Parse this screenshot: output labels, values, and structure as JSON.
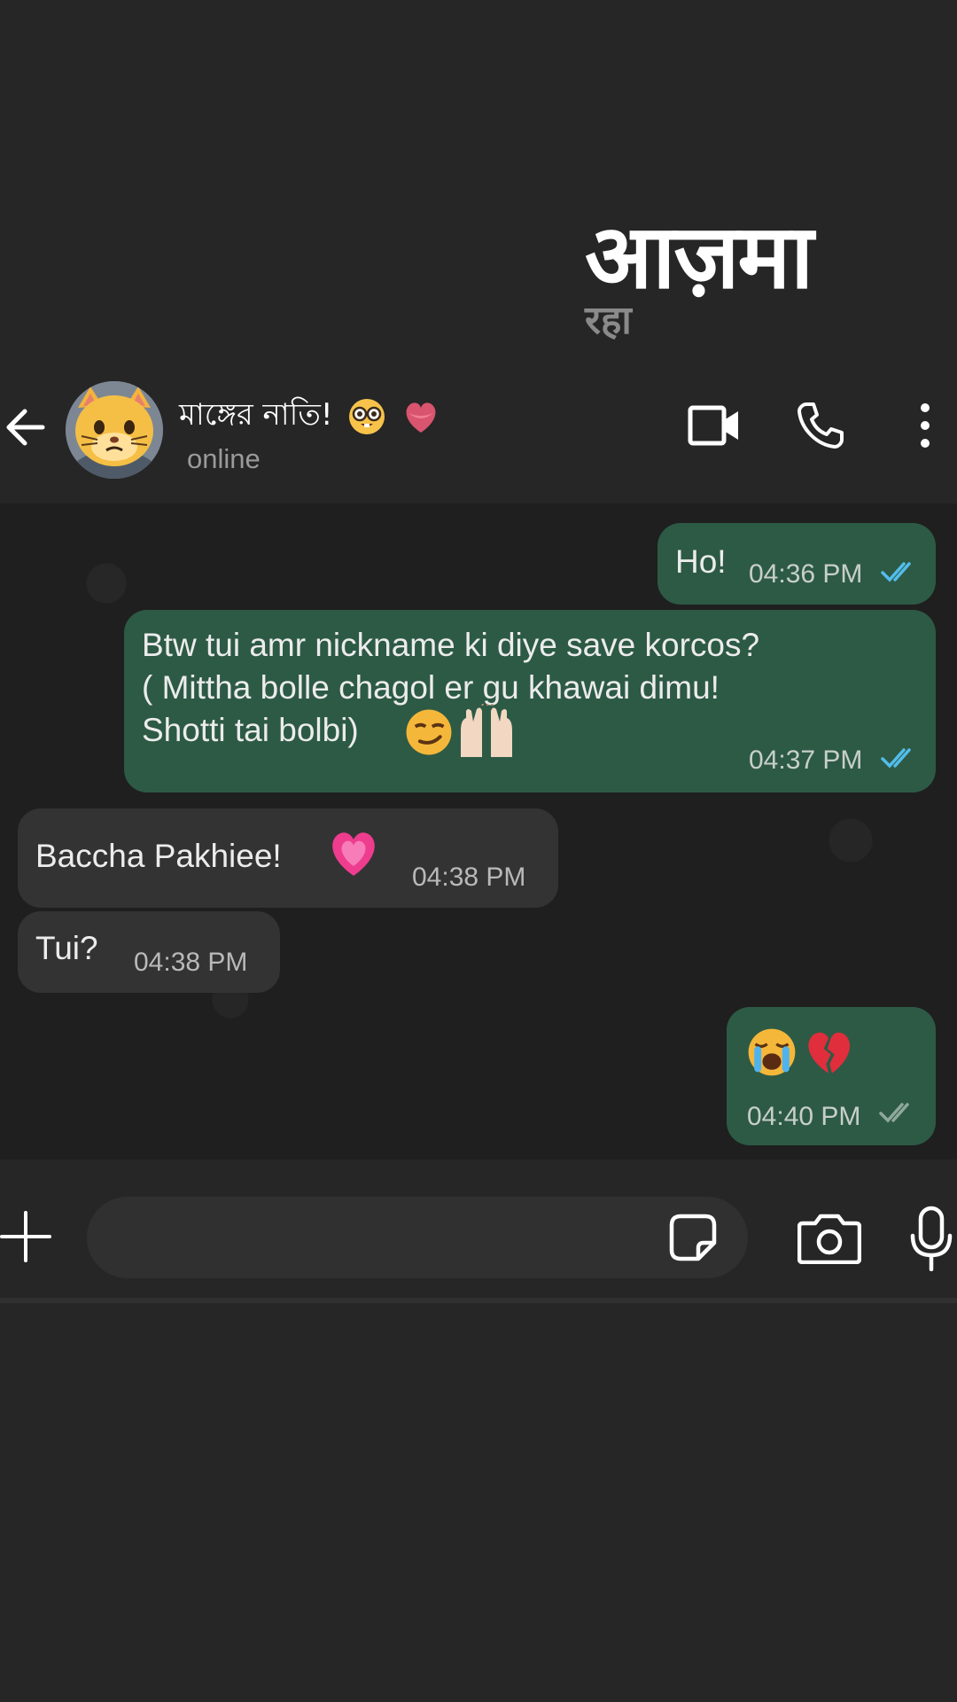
{
  "overlay": {
    "title": "आज़मा",
    "subtitle": "रहा"
  },
  "header": {
    "contact_name": "মাঙ্গের নাতি!",
    "status": "online",
    "icons": [
      "back-arrow-icon",
      "video-call-icon",
      "voice-call-icon",
      "more-options-icon"
    ]
  },
  "messages": [
    {
      "direction": "outgoing",
      "lines": [
        "Ho!"
      ],
      "time": "04:36 PM",
      "status": "read"
    },
    {
      "direction": "outgoing",
      "lines": [
        "Btw tui amr nickname ki diye save korcos?",
        "( Mittha bolle chagol er gu khawai dimu!",
        "Shotti tai bolbi)"
      ],
      "emojis": [
        "smirk",
        "raised-hands"
      ],
      "time": "04:37 PM",
      "status": "read"
    },
    {
      "direction": "incoming",
      "lines": [
        "Baccha Pakhiee!"
      ],
      "emojis": [
        "growing-heart"
      ],
      "time": "04:38 PM"
    },
    {
      "direction": "incoming",
      "lines": [
        "Tui?"
      ],
      "time": "04:38 PM"
    },
    {
      "direction": "outgoing",
      "lines": [
        ""
      ],
      "emojis": [
        "crying-face",
        "broken-heart"
      ],
      "time": "04:40 PM",
      "status": "delivered"
    }
  ],
  "input_bar": {
    "placeholder": "",
    "icons": [
      "plus-icon",
      "sticker-icon",
      "camera-icon",
      "microphone-icon"
    ]
  },
  "colors": {
    "background": "#262626",
    "outgoing_bubble": "#2d5a45",
    "incoming_bubble": "#333333",
    "read_tick": "#53bdeb",
    "delivered_tick": "#8fa89c"
  }
}
